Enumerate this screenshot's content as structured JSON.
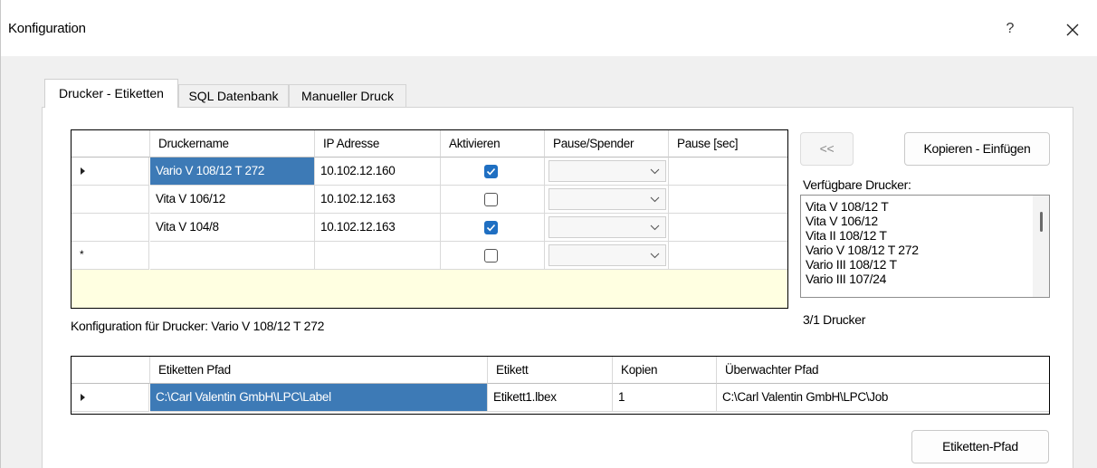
{
  "window": {
    "title": "Konfiguration",
    "help_label": "?"
  },
  "tabs": [
    {
      "label": "Drucker - Etiketten",
      "active": true
    },
    {
      "label": "SQL Datenbank",
      "active": false
    },
    {
      "label": "Manueller Druck",
      "active": false
    }
  ],
  "printer_grid": {
    "columns": [
      "Druckername",
      "IP Adresse",
      "Aktivieren",
      "Pause/Spender",
      "Pause [sec]"
    ],
    "rows": [
      {
        "name": "Vario V 108/12 T 272",
        "ip": "10.102.12.160",
        "active": true,
        "pause_spender": "",
        "pause_sec": "",
        "current": true
      },
      {
        "name": "Vita V 106/12",
        "ip": "10.102.12.163",
        "active": false,
        "pause_spender": "",
        "pause_sec": "",
        "current": false
      },
      {
        "name": "Vita V 104/8",
        "ip": "10.102.12.163",
        "active": true,
        "pause_spender": "",
        "pause_sec": "",
        "current": false
      }
    ],
    "new_row": {
      "name": "",
      "ip": "",
      "active": false,
      "pause_spender": "",
      "pause_sec": ""
    },
    "new_row_marker": "*"
  },
  "buttons": {
    "back": "<<",
    "copy_paste": "Kopieren - Einfügen",
    "label_path": "Etiketten-Pfad"
  },
  "available_printers": {
    "label": "Verfügbare Drucker:",
    "items": [
      "Vita V 108/12 T",
      "Vita V 106/12",
      "Vita II 108/12 T",
      "Vario V 108/12 T 272",
      "Vario III 108/12 T",
      "Vario III 107/24"
    ],
    "count_text": "3/1 Drucker"
  },
  "config_label": "Konfiguration für Drucker: Vario V 108/12 T 272",
  "label_grid": {
    "columns": [
      "Etiketten Pfad",
      "Etikett",
      "Kopien",
      "Überwachter Pfad"
    ],
    "rows": [
      {
        "path": "C:\\Carl Valentin GmbH\\LPC\\Label",
        "label": "Etikett1.lbex",
        "copies": "1",
        "watched_path": "C:\\Carl Valentin GmbH\\LPC\\Job"
      }
    ]
  },
  "colors": {
    "selection": "#3d7ab6",
    "checkbox_checked": "#1f6fc2",
    "new_row_area": "#ffffe1"
  },
  "icons": {
    "close": "close-icon",
    "dropdown": "chevron-down-icon",
    "row_indicator": "current-row-arrow-icon",
    "checkmark": "checkmark-icon"
  }
}
